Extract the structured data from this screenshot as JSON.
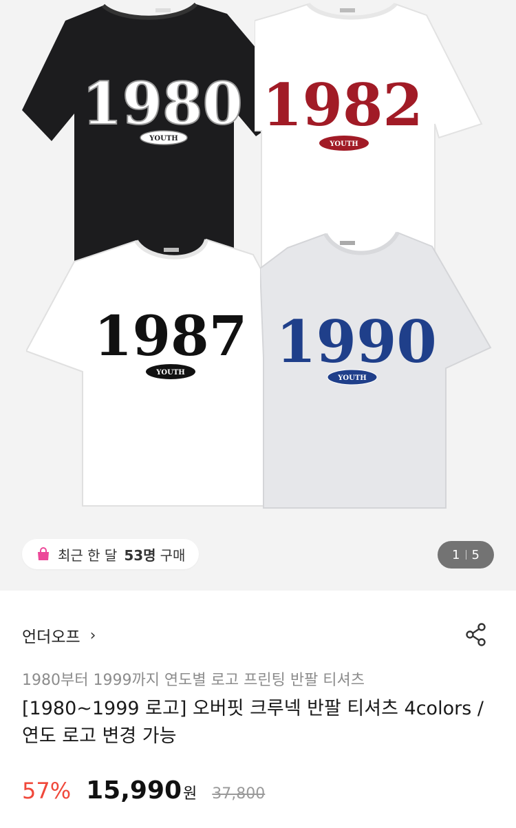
{
  "gallery": {
    "shirts": [
      {
        "year": "1980",
        "badge": "YOUTH",
        "color": "#1c1c1e",
        "print": "#ffffff"
      },
      {
        "year": "1982",
        "badge": "YOUTH",
        "color": "#ffffff",
        "print": "#a11b26"
      },
      {
        "year": "1987",
        "badge": "YOUTH",
        "color": "#ffffff",
        "print": "#111111"
      },
      {
        "year": "1990",
        "badge": "YOUTH",
        "color": "#e6e7ea",
        "print": "#1f3f8a"
      }
    ],
    "purchase_badge": {
      "prefix": "최근 한 달",
      "count": "53명",
      "suffix": "구매",
      "icon": "shopping-bag-icon",
      "icon_color": "#ec4899"
    },
    "pager": {
      "current": "1",
      "total": "5"
    }
  },
  "product": {
    "brand": "언더오프",
    "subtitle": "1980부터 1999까지 연도별 로고 프린팅 반팔 티셔츠",
    "title": "[1980~1999 로고] 오버핏 크루넥 반팔 티셔츠 4colors / 연도 로고 변경 가능",
    "discount": "57%",
    "price": "15,990",
    "currency": "원",
    "original_price": "37,800"
  },
  "colors": {
    "discount": "#f0483a"
  }
}
